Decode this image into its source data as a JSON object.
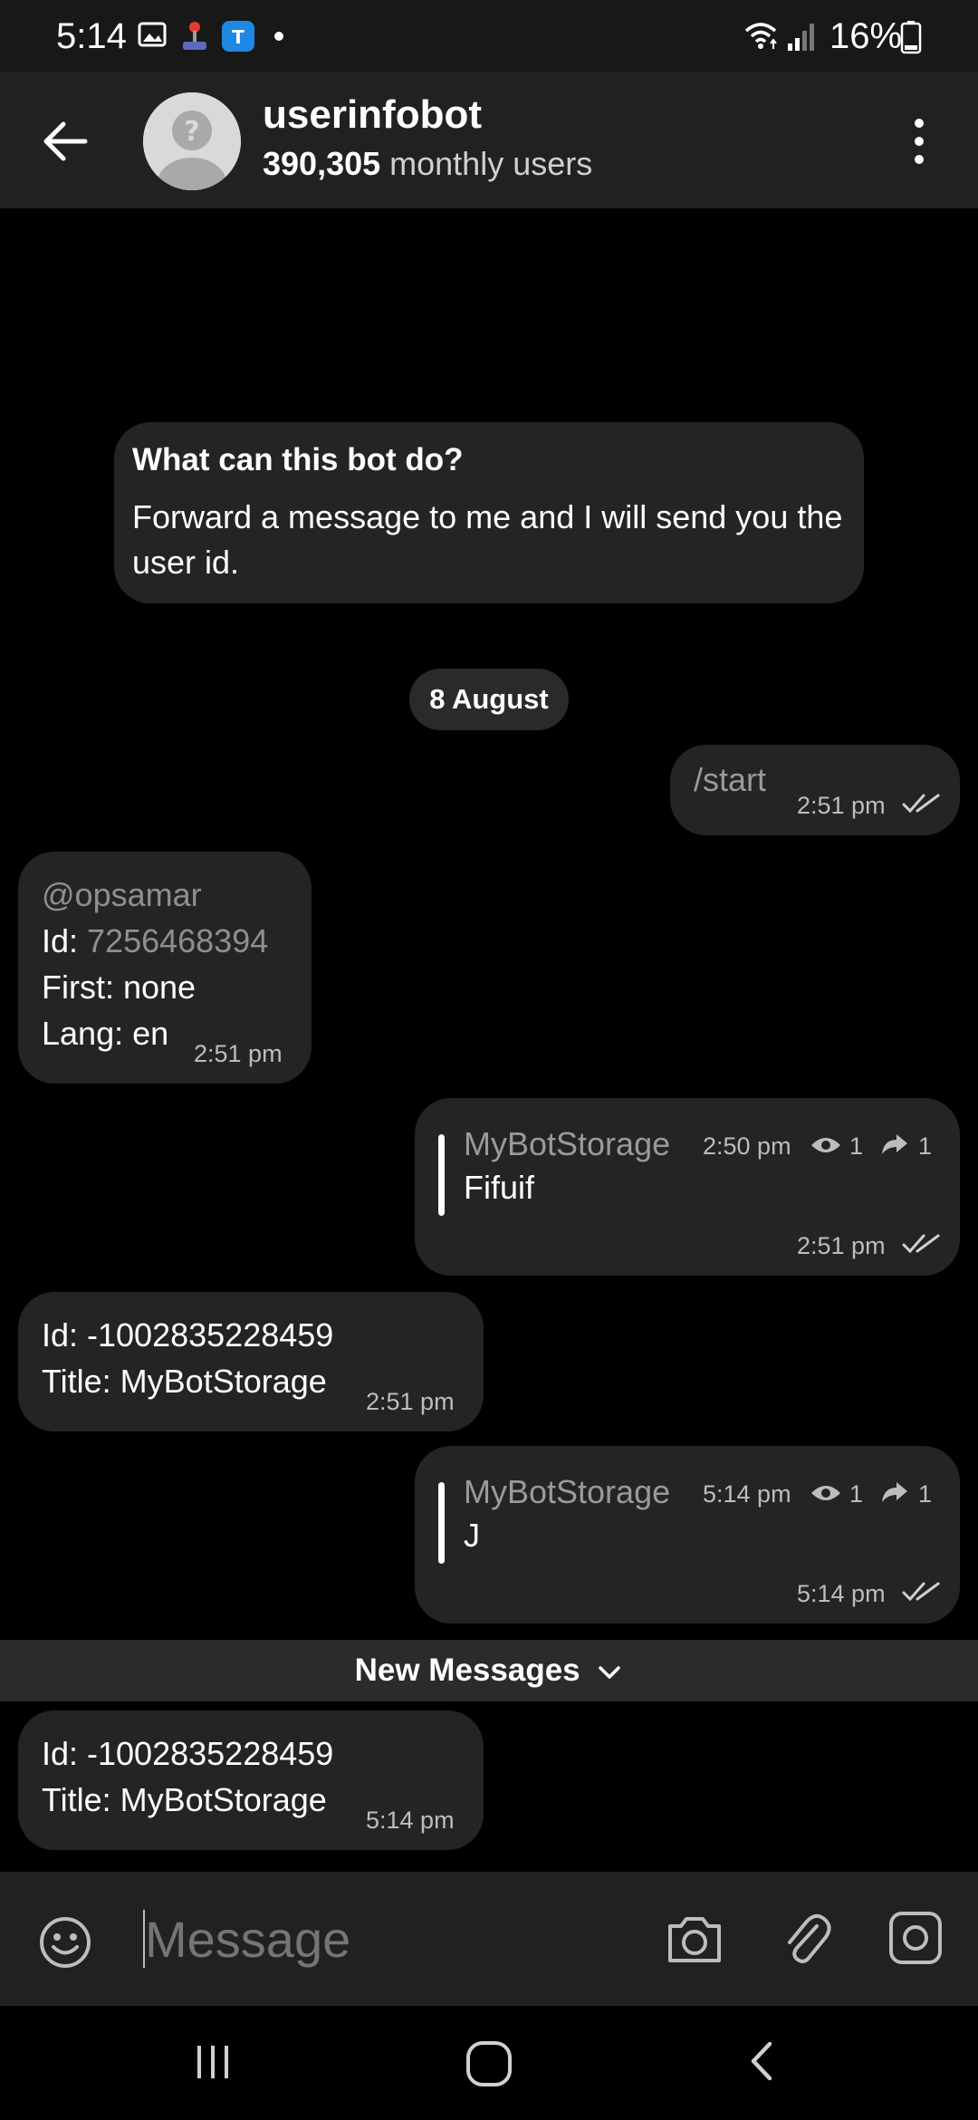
{
  "status_bar": {
    "time": "5:14",
    "battery": "16%",
    "icons": [
      "image-icon",
      "joystick-icon",
      "app-notification-icon",
      "dot-icon",
      "wifi-icon",
      "signal-icon",
      "battery-icon"
    ]
  },
  "header": {
    "name": "userinfobot",
    "users_count": "390,305",
    "users_label": " monthly users",
    "back_icon": "arrow-left-icon",
    "menu_icon": "more-vertical-icon"
  },
  "bot_info": {
    "title": "What can this bot do?",
    "description": "Forward a message to me and I will send you the user id."
  },
  "date_separator": "8 August",
  "messages": [
    {
      "dir": "out",
      "text": "/start",
      "time": "2:51 pm"
    },
    {
      "dir": "in",
      "username": "@opsamar",
      "id_label": "Id: ",
      "id_value": "7256468394",
      "first": "First: none",
      "lang": "Lang: en",
      "time": "2:51 pm"
    },
    {
      "dir": "out",
      "forward_from": "MyBotStorage",
      "forward_time": "2:50 pm",
      "views": "1",
      "shares": "1",
      "text": "Fifuif",
      "time": "2:51 pm"
    },
    {
      "dir": "in",
      "id": "Id: -1002835228459",
      "title": "Title: MyBotStorage",
      "time": "2:51 pm"
    },
    {
      "dir": "out",
      "forward_from": "MyBotStorage",
      "forward_time": "5:14 pm",
      "views": "1",
      "shares": "1",
      "text": "J",
      "time": "5:14 pm"
    },
    {
      "dir": "in",
      "id": "Id: -1002835228459",
      "title": "Title: MyBotStorage",
      "time": "5:14 pm"
    }
  ],
  "new_messages_label": "New Messages",
  "composer": {
    "placeholder": "Message"
  },
  "colors": {
    "background": "#000000",
    "bubble": "#242424",
    "header": "#212121",
    "muted_text": "#8f8f8f"
  }
}
